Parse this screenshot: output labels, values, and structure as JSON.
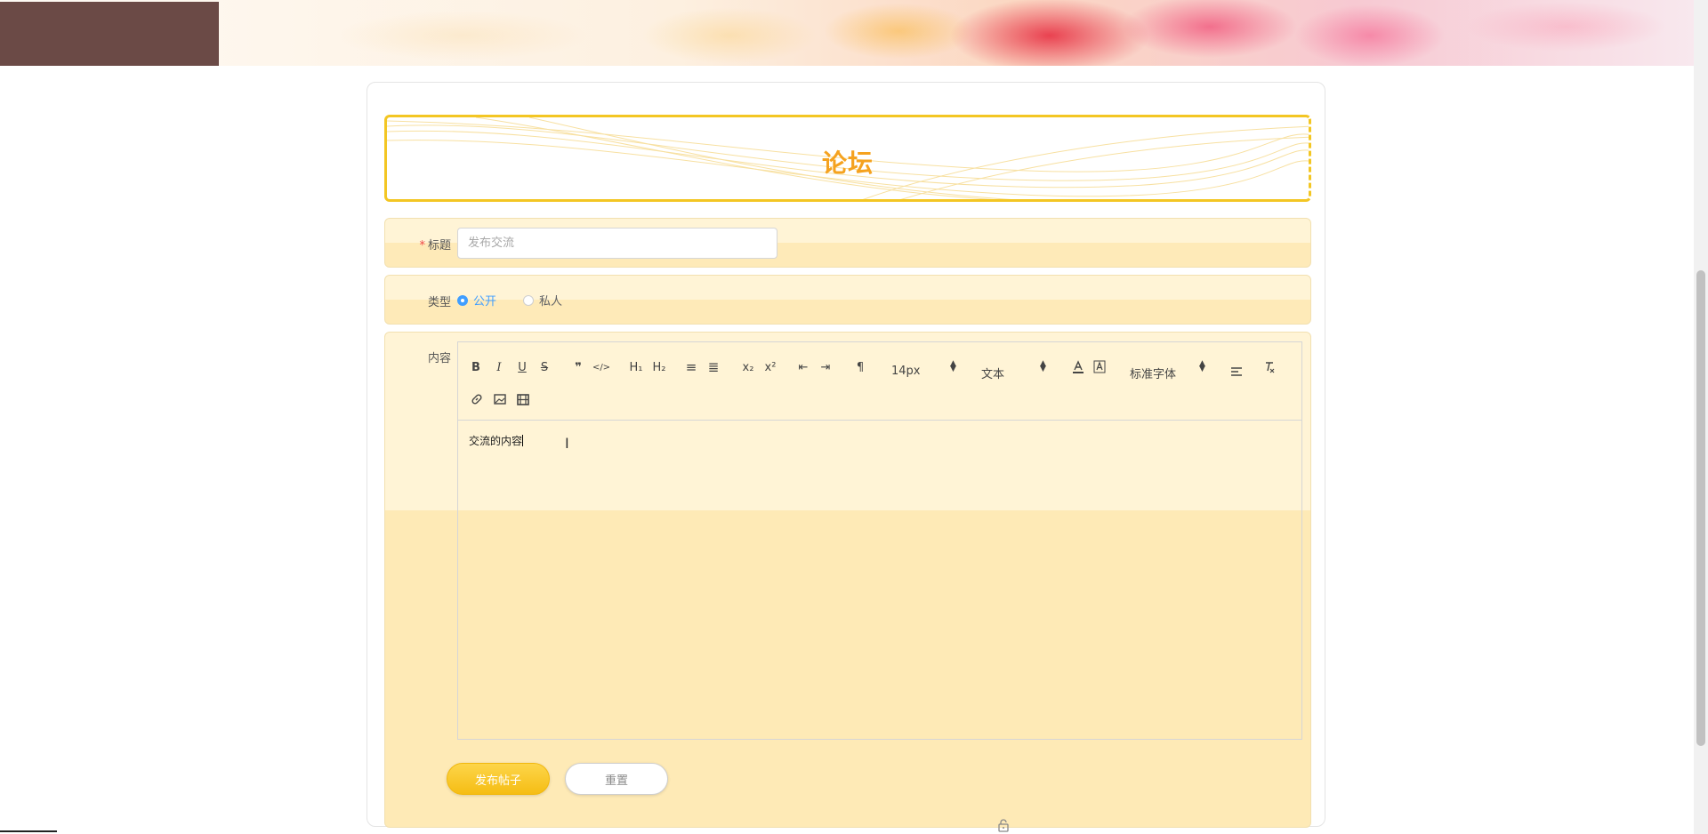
{
  "page": {
    "title": "论坛"
  },
  "form": {
    "title_label": "标题",
    "title_required_mark": "*",
    "title_placeholder": "发布交流",
    "title_value": "",
    "type_label": "类型",
    "type_options": [
      {
        "label": "公开",
        "checked": true
      },
      {
        "label": "私人",
        "checked": false
      }
    ],
    "content_label": "内容",
    "content_text": "交流的内容"
  },
  "editor": {
    "toolbar": {
      "bold": "B",
      "italic": "I",
      "underline": "U",
      "strike": "S",
      "blockquote": "❞",
      "code": "</>",
      "h1": "H₁",
      "h2": "H₂",
      "ordered_list": "≡",
      "bullet_list": "≣",
      "subscript": "x₂",
      "superscript": "x²",
      "outdent": "⇤",
      "indent": "⇥",
      "direction": "¶",
      "size_select": "14px",
      "header_select": "文本",
      "font_select": "标准字体"
    }
  },
  "buttons": {
    "publish": "发布帖子",
    "reset": "重置"
  },
  "colors": {
    "accent_orange": "#f5a21f",
    "banner_border": "#f3c623",
    "row_light": "#fff4d6",
    "row_dark": "#feeab8",
    "radio_active": "#409eff",
    "publish_button": "#f5bd14"
  }
}
